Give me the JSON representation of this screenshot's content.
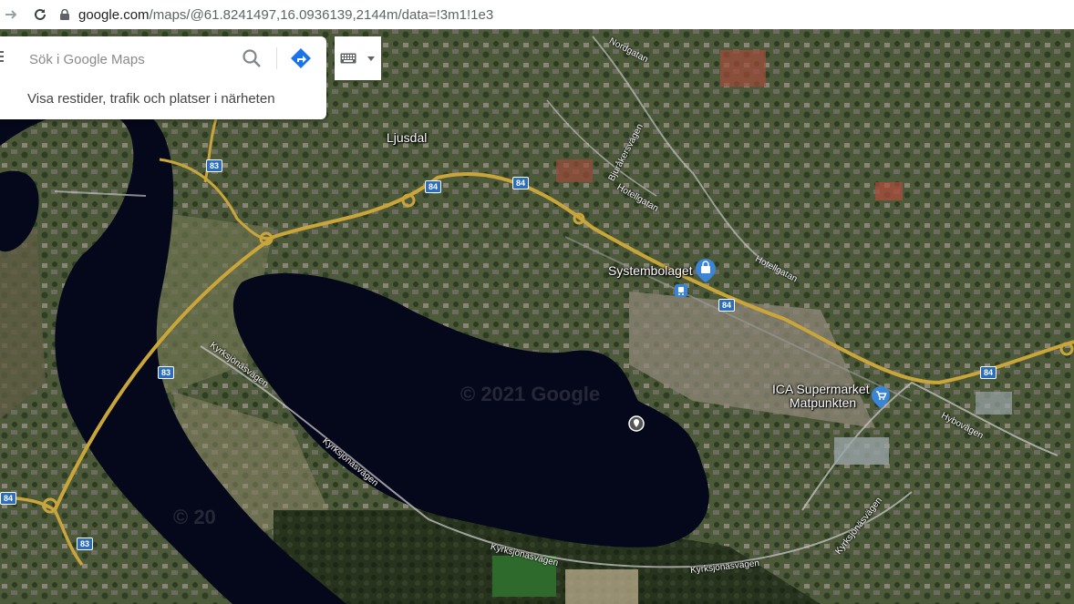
{
  "browser": {
    "url_host": "google.com",
    "url_path": "/maps/@61.8241497,16.0936139,2144m/data=!3m1!1e3"
  },
  "search": {
    "placeholder": "Sök i Google Maps",
    "hint": "Visa restider, trafik och platser i närheten"
  },
  "map": {
    "view": "satellite",
    "watermark": "© 2021 Google",
    "watermark_partial": "© 20",
    "places": {
      "town": "Ljusdal",
      "systembolaget": "Systembolaget",
      "ica_line1": "ICA Supermarket",
      "ica_line2": "Matpunkten"
    },
    "streets": {
      "nordgatan": "Nordgatan",
      "bjurakersvagen": "Bjuråkersvägen",
      "hotellgatan_1": "Hotellgatan",
      "hotellgatan_2": "Hotellgatan",
      "hybovagen": "Hybovägen",
      "kyrksjonasvagen_1": "Kyrksjönäsvägen",
      "kyrksjonasvagen_2": "Kyrksjönäsvägen",
      "kyrksjonasvagen_3": "Kyrksjönäsvägen",
      "kyrksjonasvagen_4": "Kyrksjönäsvägen",
      "kyrksjonasvagen_5": "Kyrksjönäsvägen"
    },
    "route_shields": {
      "r83a": "83",
      "r83b": "83",
      "r83c": "83",
      "r84a": "84",
      "r84b": "84",
      "r84c": "84",
      "r84d": "84",
      "r84e": "84"
    },
    "colors": {
      "water": "#05081a",
      "shield": "#2a6ebd",
      "road_major": "#c9a53a",
      "poi_blue": "#3a85d8"
    }
  }
}
